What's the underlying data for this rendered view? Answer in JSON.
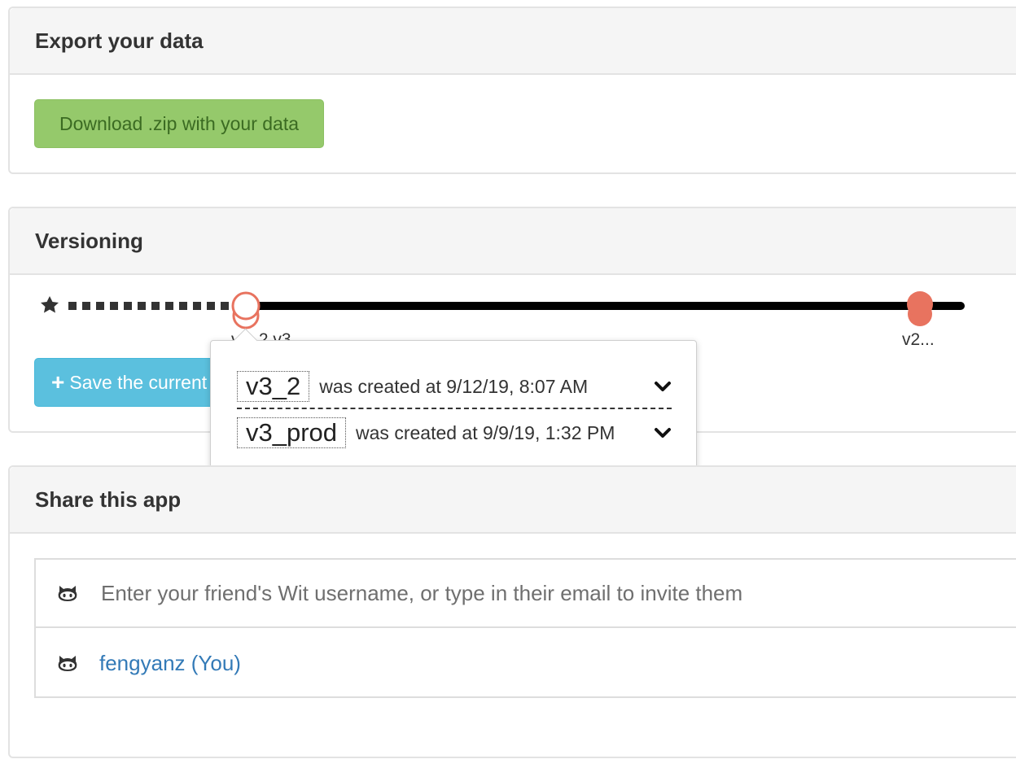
{
  "export": {
    "title": "Export your data",
    "download_label": "Download .zip with your data"
  },
  "versioning": {
    "title": "Versioning",
    "save_label": "Save the current version",
    "timeline_labels": [
      "v3_2 v3...",
      "v2..."
    ],
    "versions": [
      {
        "tag": "v3_2",
        "text": "was created at 9/12/19, 8:07 AM"
      },
      {
        "tag": "v3_prod",
        "text": "was created at 9/9/19, 1:32 PM"
      }
    ],
    "colors": {
      "marker": "#e8735f",
      "line": "#000000",
      "accent_save": "#5bc0de",
      "accent_download": "#95c96b"
    }
  },
  "share": {
    "title": "Share this app",
    "input_placeholder": "Enter your friend's Wit username, or type in their email to invite them",
    "members": [
      {
        "name": "fengyanz (You)"
      }
    ],
    "icon": "github-octocat-icon"
  }
}
